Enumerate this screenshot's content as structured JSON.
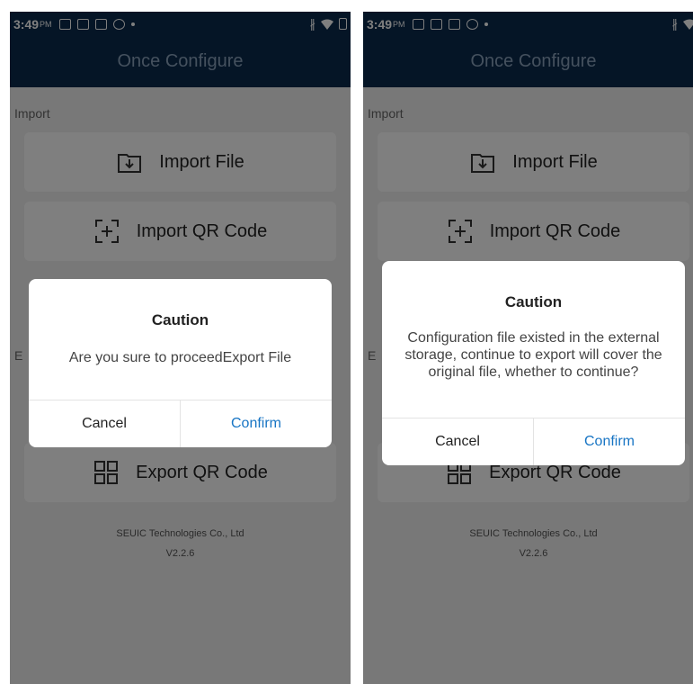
{
  "status": {
    "time": "3:49",
    "ampm": "PM",
    "bluetooth_symbol": "∦"
  },
  "app": {
    "title": "Once Configure",
    "import_label": "Import",
    "import_file": "Import File",
    "import_qr": "Import QR Code",
    "export_label_partial": "E",
    "export_qr": "Export QR Code",
    "company": "SEUIC Technologies Co., Ltd",
    "version": "V2.2.6"
  },
  "dialogs": {
    "left": {
      "title": "Caution",
      "message": "Are you sure to proceedExport File",
      "cancel": "Cancel",
      "confirm": "Confirm"
    },
    "right": {
      "title": "Caution",
      "message": "Configuration file existed in the external storage, continue to export will cover the original file, whether to continue?",
      "cancel": "Cancel",
      "confirm": "Confirm"
    }
  },
  "colors": {
    "appbar": "#0a2b4d",
    "accent": "#1875c4",
    "overlay": "rgba(0,0,0,0.5)"
  }
}
